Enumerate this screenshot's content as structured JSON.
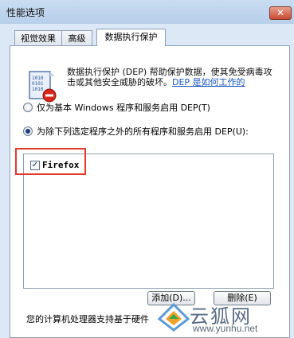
{
  "window": {
    "title": "性能选项",
    "close_glyph": "✕"
  },
  "tabs": [
    {
      "label": "视觉效果",
      "active": false
    },
    {
      "label": "高级",
      "active": false
    },
    {
      "label": "数据执行保护",
      "active": true
    }
  ],
  "dep": {
    "icon": "dep-shield-icon",
    "description": "数据执行保护 (DEP) 帮助保护数据，使其免受病毒攻击或其他安全威胁的破坏。",
    "link": "DEP 是如何工作的"
  },
  "options": [
    {
      "label": "仅为基本 Windows 程序和服务启用 DEP(T)",
      "checked": false
    },
    {
      "label": "为除下列选定程序之外的所有程序和服务启用 DEP(U):",
      "checked": true
    }
  ],
  "exceptions": [
    {
      "label": "Firefox",
      "checked": true,
      "check_glyph": "✓"
    }
  ],
  "buttons": {
    "add": "添加(D)...",
    "remove": "删除(E)"
  },
  "status": "您的计算机处理器支持基于硬件",
  "watermark": {
    "cn": "云狐网",
    "url": "www.yunhu.net"
  },
  "colors": {
    "highlight": "#e23a2d",
    "link": "#1a55c4",
    "accent": "#b7cfea"
  }
}
